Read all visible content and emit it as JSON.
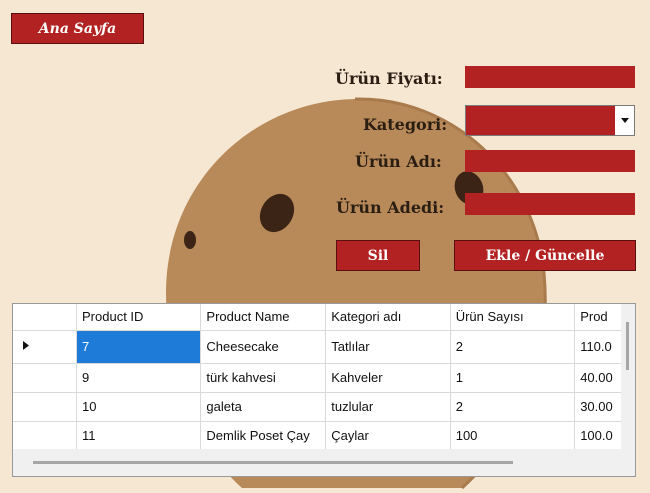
{
  "nav": {
    "home_label": "Ana Sayfa"
  },
  "form": {
    "price_label": "Ürün Fiyatı:",
    "category_label": "Kategori:",
    "name_label": "Ürün Adı:",
    "quantity_label": "Ürün Adedi:",
    "price_value": "",
    "category_value": "",
    "name_value": "",
    "quantity_value": ""
  },
  "actions": {
    "delete_label": "Sil",
    "save_label": "Ekle / Güncelle"
  },
  "grid": {
    "columns": [
      "Product ID",
      "Product Name",
      "Kategori adı",
      "Ürün Sayısı",
      "Prod"
    ],
    "rows": [
      [
        "7",
        "Cheesecake",
        "Tatlılar",
        "2",
        "110.0"
      ],
      [
        "9",
        "türk kahvesi",
        "Kahveler",
        "1",
        "40.00"
      ],
      [
        "10",
        "galeta",
        "tuzlular",
        "2",
        "30.00"
      ],
      [
        "11",
        "Demlik Poset Çay",
        "Çaylar",
        "100",
        "100.0"
      ]
    ],
    "selected_row": 0
  },
  "colors": {
    "accent": "#b22222",
    "background": "#f6e7d3",
    "selection": "#1e7bd8"
  }
}
